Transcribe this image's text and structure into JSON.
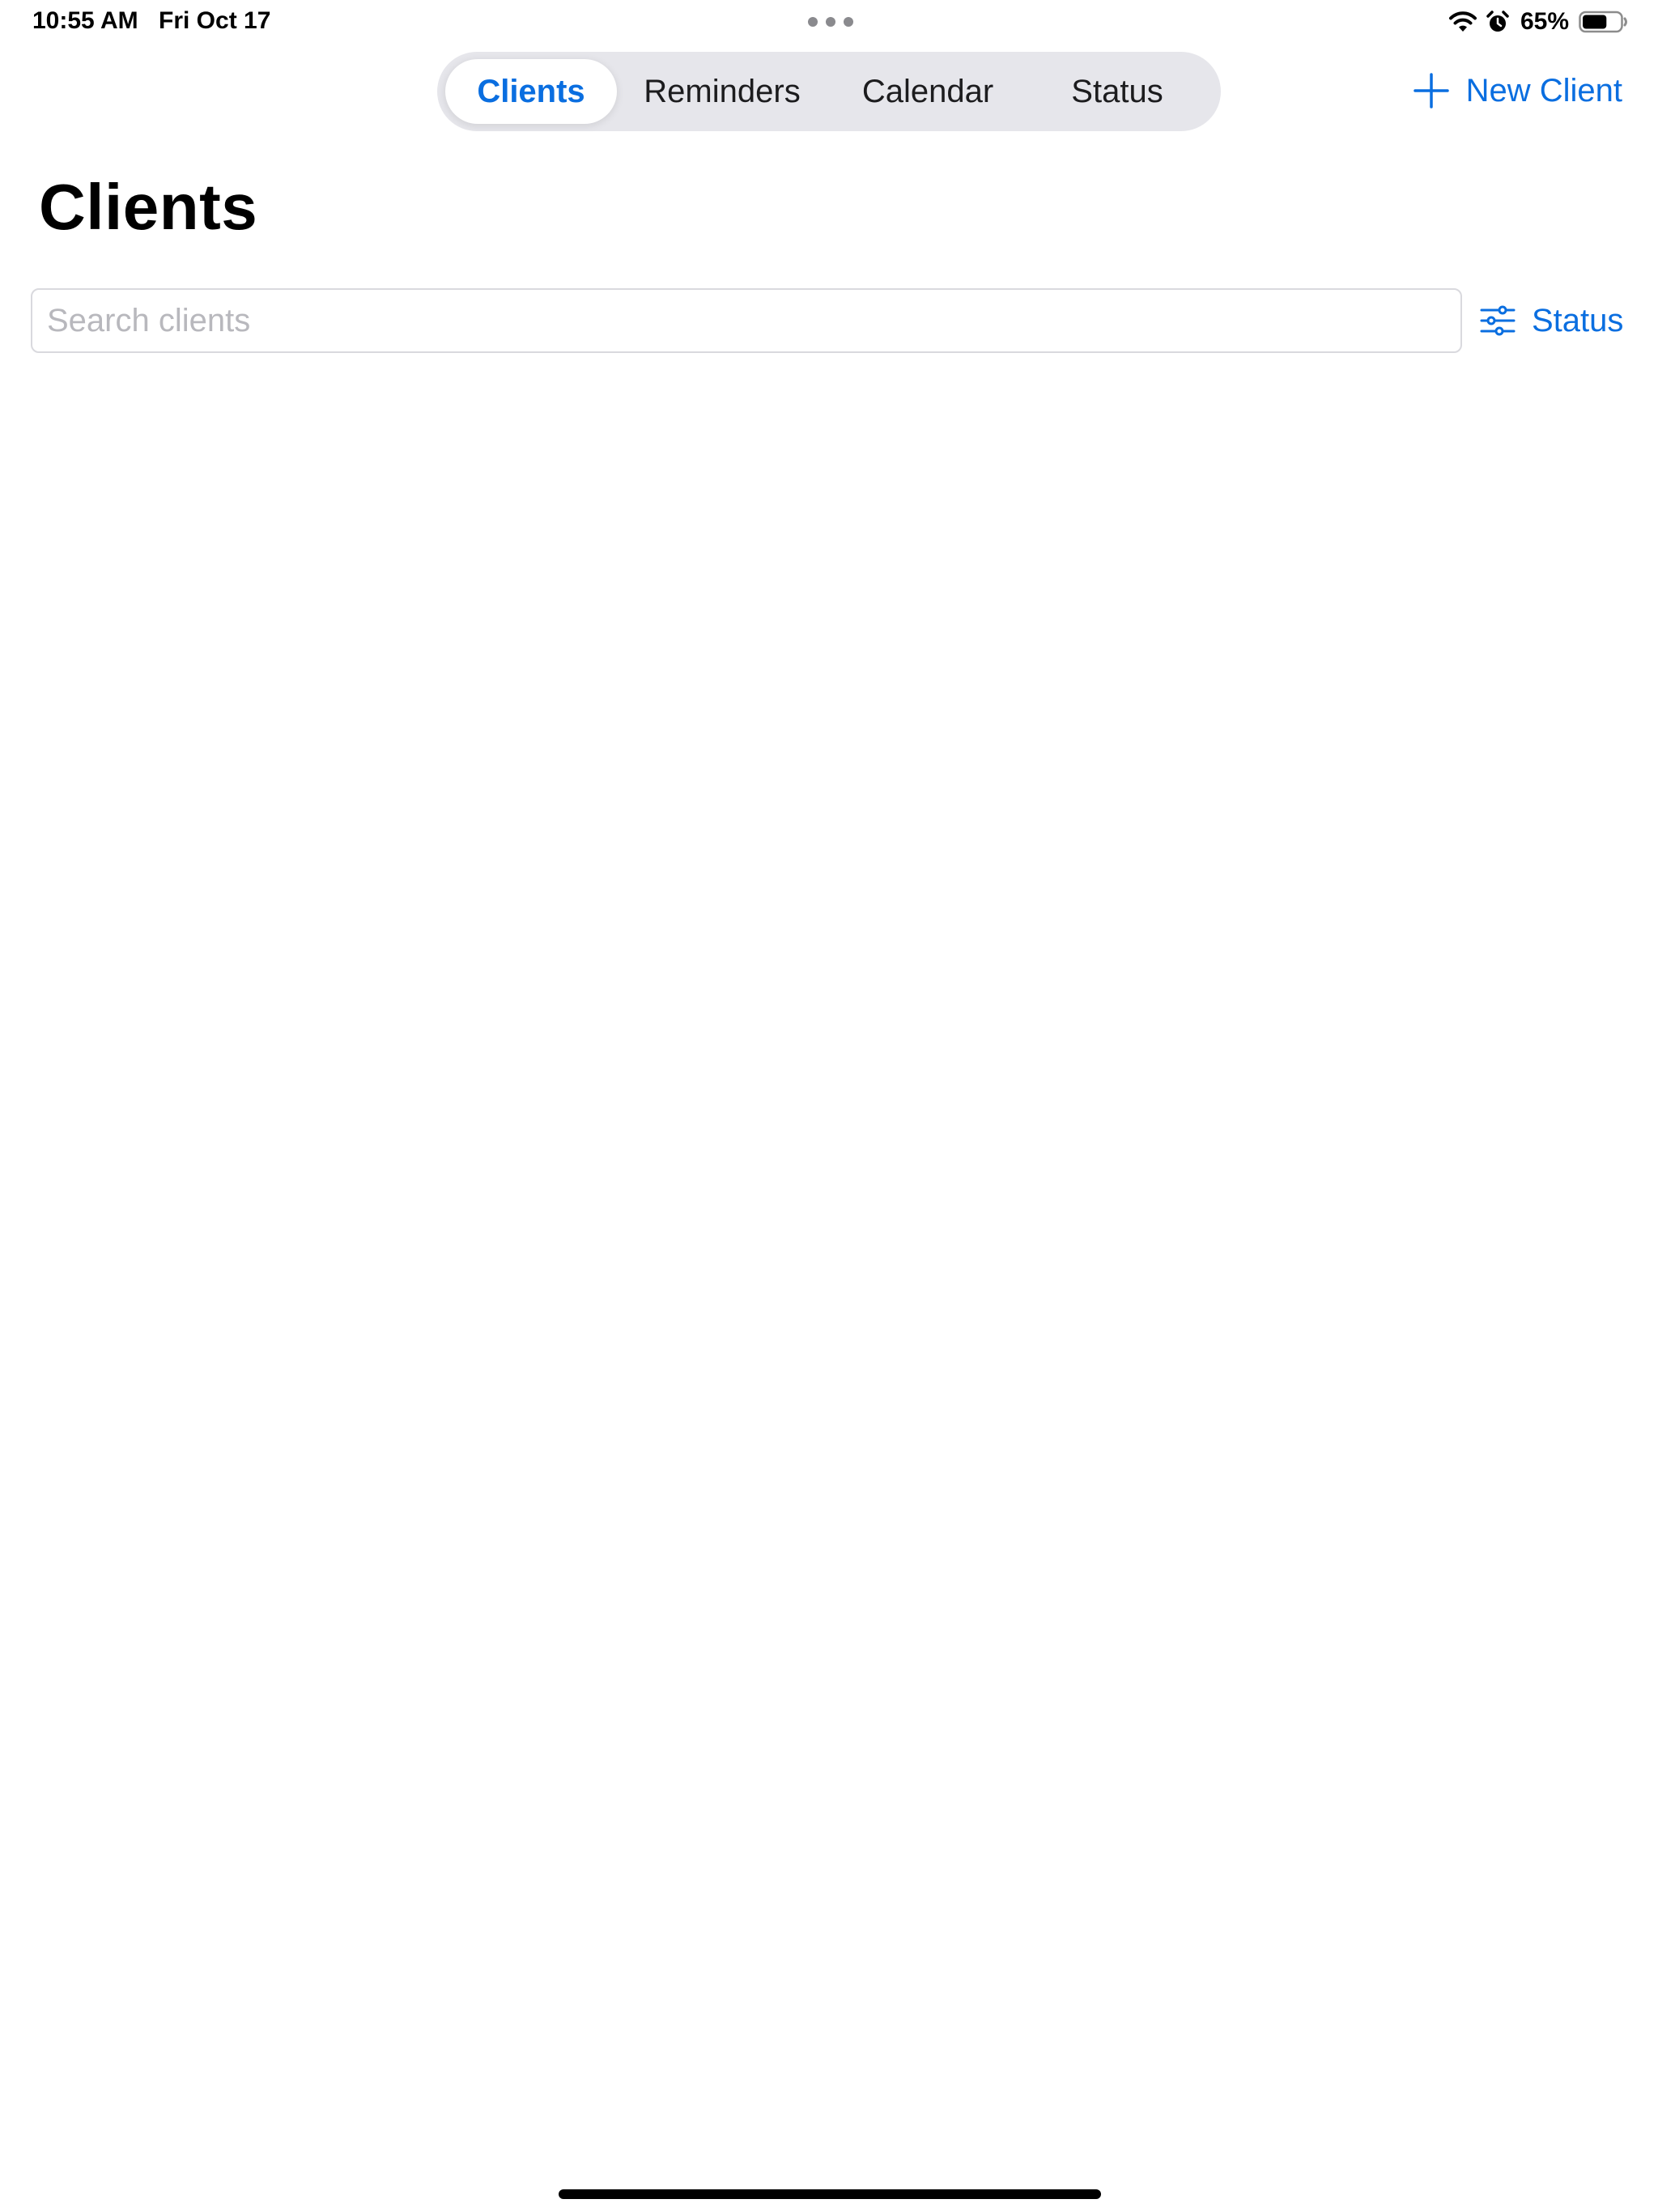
{
  "status_bar": {
    "time": "10:55 AM",
    "date": "Fri Oct 17",
    "battery_percent": "65%",
    "battery_level": 0.65,
    "icons": [
      "wifi-icon",
      "alarm-icon",
      "battery-icon",
      "multitask-dots-icon"
    ]
  },
  "tabs": [
    {
      "label": "Clients",
      "selected": true
    },
    {
      "label": "Reminders",
      "selected": false
    },
    {
      "label": "Calendar",
      "selected": false
    },
    {
      "label": "Status",
      "selected": false
    }
  ],
  "toolbar": {
    "new_client_label": "New Client",
    "new_client_icon": "plus-icon"
  },
  "page": {
    "title": "Clients"
  },
  "search": {
    "placeholder": "Search clients",
    "value": ""
  },
  "filter": {
    "label": "Status",
    "icon": "sliders-icon"
  },
  "colors": {
    "accent": "#0a6ee0",
    "segment_background": "#e6e6eb",
    "placeholder": "#b8b8bd"
  }
}
